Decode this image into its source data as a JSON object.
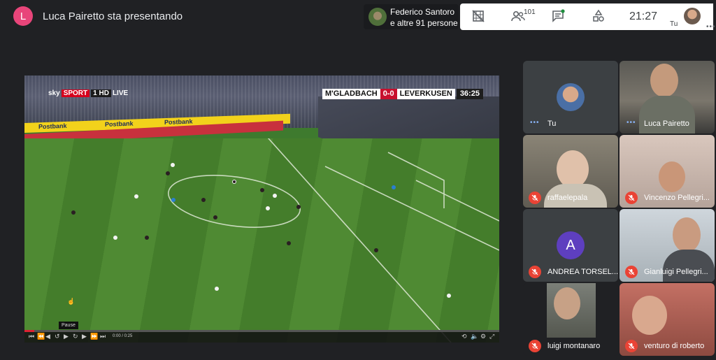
{
  "topbar": {
    "presenter_initial": "L",
    "presenter_text": "Luca Pairetto sta presentando",
    "participants_line1": "Federico Santoro",
    "participants_line2": "e altre 91 persone",
    "participant_count": "101",
    "clock": "21:27",
    "self_label": "Tu"
  },
  "icons": {
    "no_present": "present-off-icon",
    "people": "people-icon",
    "chat": "chat-icon",
    "activities": "activities-icon",
    "overflow": "more-icon"
  },
  "video": {
    "channel": "sky",
    "channel_sport": "SPORT",
    "channel_hd": "1 HD",
    "channel_live": "LIVE",
    "home_team": "M'GLADBACH",
    "score": "0-0",
    "away_team": "LEVERKUSEN",
    "match_time": "36:25",
    "ad_postbank": "Postbank",
    "ad_postbank2": "Postbank",
    "ad_postbank3": "Postbank",
    "pause_tooltip": "Pause",
    "time_readout": "0:00 / 0:25",
    "progress": 0.02
  },
  "tiles": [
    {
      "name": "Tu",
      "muted": false,
      "kind": "self"
    },
    {
      "name": "Luca Pairetto",
      "muted": false,
      "kind": "video"
    },
    {
      "name": "raffaelepala",
      "muted": true,
      "kind": "video"
    },
    {
      "name": "Vincenzo Pellegri...",
      "muted": true,
      "kind": "video"
    },
    {
      "name": "ANDREA TORSEL...",
      "muted": true,
      "kind": "avatar",
      "initial": "A"
    },
    {
      "name": "Gianluigi Pellegri...",
      "muted": true,
      "kind": "video"
    },
    {
      "name": "luigi montanaro",
      "muted": true,
      "kind": "video"
    },
    {
      "name": "venturo di roberto",
      "muted": true,
      "kind": "video"
    }
  ],
  "colors": {
    "presenter_avatar": "#e8457a",
    "mic_off": "#ea4335",
    "avatar_purple": "#5e3fbf",
    "background": "#202124"
  }
}
